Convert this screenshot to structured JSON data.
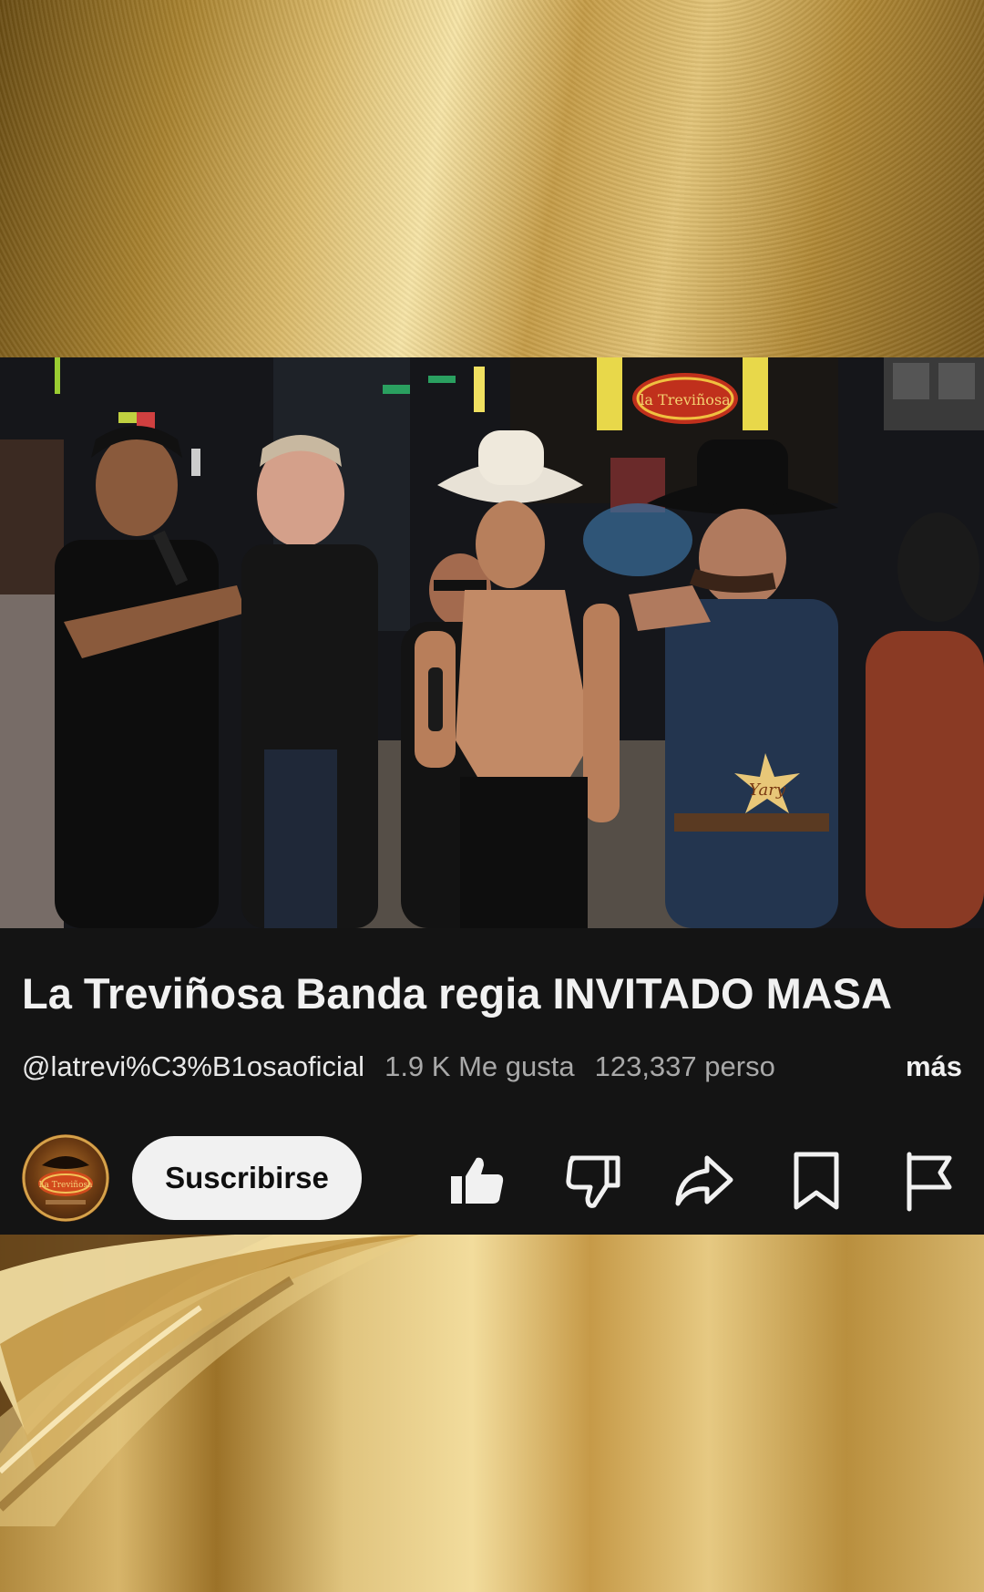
{
  "video": {
    "title": "La Treviñosa Banda regia INVITADO MASA",
    "watermark_text": "Yary",
    "sign_text": "la Treviñosa"
  },
  "channel": {
    "handle": "@latrevi%C3%B1osaoficial",
    "avatar_text": "La Treviñosa"
  },
  "stats": {
    "likes": "1.9 K Me gusta",
    "views": "123,337 perso",
    "more": "más"
  },
  "actions": {
    "subscribe_label": "Suscribirse",
    "icons": [
      "like-icon",
      "dislike-icon",
      "share-icon",
      "save-icon",
      "report-icon"
    ]
  },
  "colors": {
    "gold": "#d9b868",
    "panel": "#141414",
    "text": "#f1f1f1",
    "secondary_text": "#a9a9a9"
  }
}
